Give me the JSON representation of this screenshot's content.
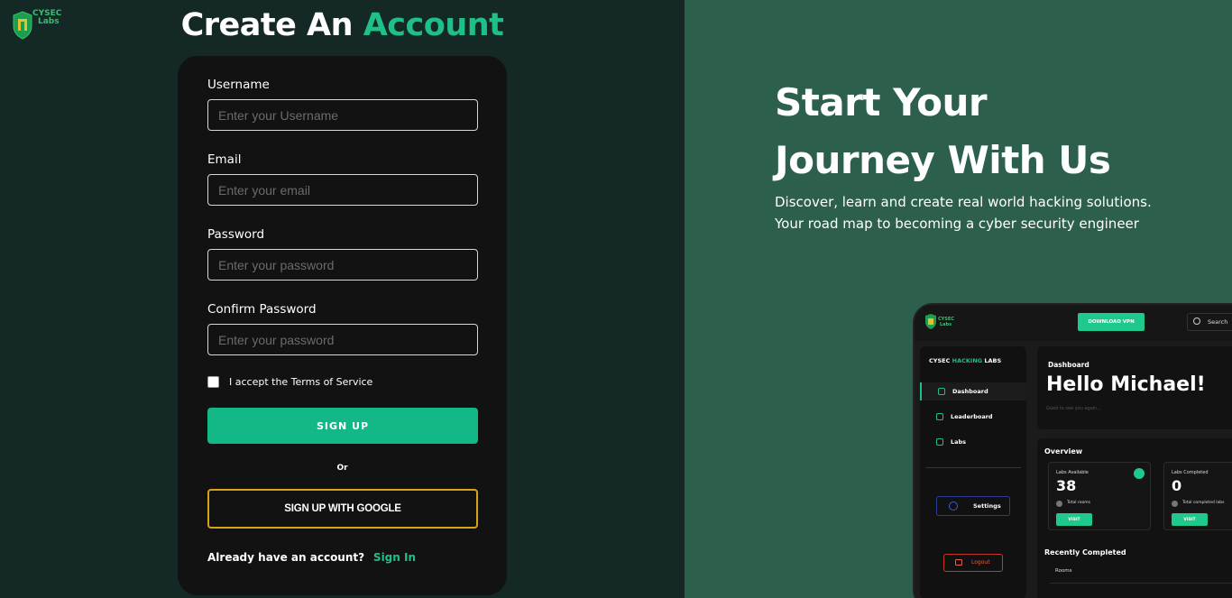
{
  "brand": {
    "logo_line1": "CYSEC",
    "logo_line2": "Labs"
  },
  "form": {
    "heading_prefix": "Create An",
    "heading_accent": "Account",
    "username_label": "Username",
    "username_placeholder": "Enter your Username",
    "email_label": "Email",
    "email_placeholder": "Enter your email",
    "password_label": "Password",
    "password_placeholder": "Enter your password",
    "confirm_label": "Confirm Password",
    "confirm_placeholder": "Enter your password",
    "terms_label": "I accept the Terms of Service",
    "terms_checked": false,
    "signup_label": "SIGN UP",
    "or_label": "Or",
    "google_label": "SIGN UP WITH GOOGLE",
    "signin_question": "Already have an account?",
    "signin_link": "Sign In"
  },
  "hero": {
    "title_line1": "Start Your",
    "title_line2": "Journey With Us",
    "sub_line1": "Discover, learn and create real world hacking solutions.",
    "sub_line2": "Your road map to becoming a cyber security engineer"
  },
  "mockup": {
    "download_btn": "DOWNLOAD VPN",
    "search": "Search",
    "brand_a": "CYSEC ",
    "brand_b": "HACKING",
    "brand_c": " LABS",
    "nav": [
      "Dashboard",
      "Leaderboard",
      "Labs"
    ],
    "settings": "Settings",
    "logout": "Logout",
    "dashboard_label": "Dashboard",
    "hello": "Hello Michael!",
    "greet": "Good to see you again...",
    "overview": "Overview",
    "stats": [
      {
        "label": "Labs Available",
        "value": "38",
        "sub": "Total rooms",
        "button": "VISIT"
      },
      {
        "label": "Labs Completed",
        "value": "0",
        "sub": "Total completed labs",
        "button": "VISIT"
      }
    ],
    "recent": "Recently Completed",
    "rooms": "Rooms"
  },
  "colors": {
    "accent": "#1fbf88",
    "button": "#12b886",
    "google_border": "#d8a218",
    "left_bg": "#142826",
    "right_bg": "#2d604c",
    "card_bg": "#121212"
  }
}
